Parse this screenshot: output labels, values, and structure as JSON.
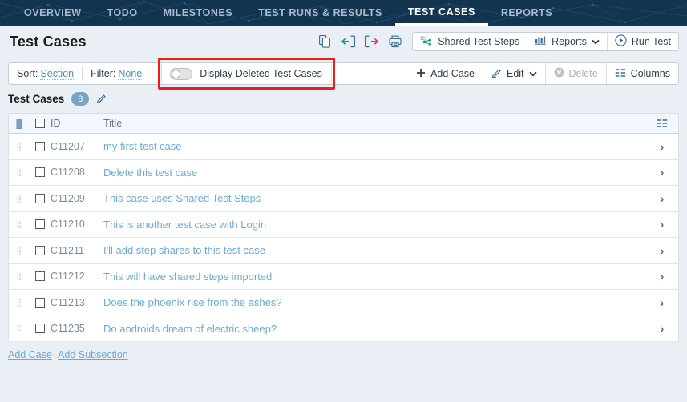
{
  "nav": {
    "tabs": [
      {
        "label": "OVERVIEW",
        "active": false
      },
      {
        "label": "TODO",
        "active": false
      },
      {
        "label": "MILESTONES",
        "active": false
      },
      {
        "label": "TEST RUNS & RESULTS",
        "active": false
      },
      {
        "label": "TEST CASES",
        "active": true
      },
      {
        "label": "REPORTS",
        "active": false
      }
    ],
    "background_color": "#12344f",
    "active_color": "#ffffff",
    "inactive_color": "#a9bccd"
  },
  "header": {
    "title": "Test Cases",
    "icons": [
      {
        "name": "copy-icon",
        "title": "Copy"
      },
      {
        "name": "import-icon",
        "title": "Import"
      },
      {
        "name": "export-icon",
        "title": "Export"
      },
      {
        "name": "print-icon",
        "title": "Print"
      }
    ],
    "buttons": [
      {
        "label": "Shared Test Steps",
        "icon": "shared-steps-icon"
      },
      {
        "label": "Reports",
        "icon": "reports-chart-icon",
        "caret": true
      },
      {
        "label": "Run Test",
        "icon": "play-circle-icon"
      }
    ]
  },
  "filterbar": {
    "sort_label": "Sort:",
    "sort_value": "Section",
    "filter_label": "Filter:",
    "filter_value": "None",
    "toggle": {
      "label": "Display Deleted Test Cases",
      "state": "off",
      "highlight_color": "#ee1c1c"
    },
    "actions": [
      {
        "label": "Add Case",
        "icon": "plus-icon",
        "disabled": false
      },
      {
        "label": "Edit",
        "icon": "pencil-icon",
        "caret": true,
        "disabled": false
      },
      {
        "label": "Delete",
        "icon": "delete-circle-icon",
        "disabled": true
      },
      {
        "label": "Columns",
        "icon": "columns-icon",
        "disabled": false
      }
    ]
  },
  "section": {
    "name": "Test Cases",
    "count": "8",
    "edit_icon": "pencil-icon"
  },
  "table": {
    "columns": {
      "id": "ID",
      "title": "Title"
    },
    "header_icons": {
      "left": "column-resize-icon",
      "checkbox": "select-all-checkbox",
      "right": "column-options-icon"
    },
    "rows": [
      {
        "id": "C11207",
        "title": "my first test case"
      },
      {
        "id": "C11208",
        "title": "Delete this test case"
      },
      {
        "id": "C11209",
        "title": "This case uses Shared Test Steps"
      },
      {
        "id": "C11210",
        "title": "This is another test case with Login"
      },
      {
        "id": "C11211",
        "title": "I'll add step shares to this test case"
      },
      {
        "id": "C11212",
        "title": "This will have shared steps imported"
      },
      {
        "id": "C11213",
        "title": "Does the phoenix rise from the ashes?"
      },
      {
        "id": "C11235",
        "title": "Do androids dream of electric sheep?"
      }
    ]
  },
  "footer": {
    "add_case": "Add Case",
    "separator": "|",
    "add_subsection": "Add Subsection"
  }
}
